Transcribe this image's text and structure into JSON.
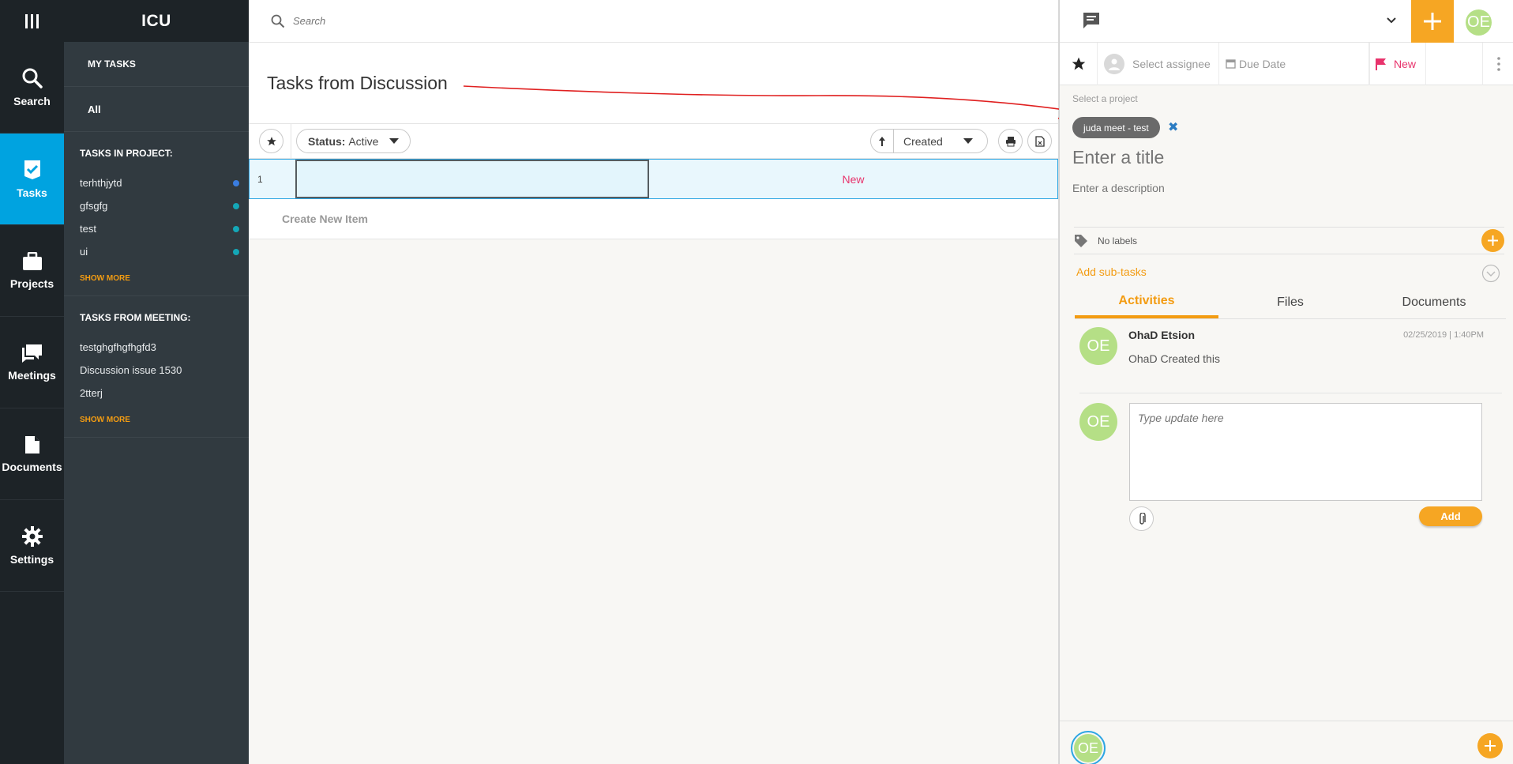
{
  "app": {
    "name": "ICU"
  },
  "rail": [
    {
      "key": "search",
      "label": "Search"
    },
    {
      "key": "tasks",
      "label": "Tasks"
    },
    {
      "key": "projects",
      "label": "Projects"
    },
    {
      "key": "meetings",
      "label": "Meetings"
    },
    {
      "key": "documents",
      "label": "Documents"
    },
    {
      "key": "settings",
      "label": "Settings"
    }
  ],
  "subnav": {
    "my_tasks": "MY TASKS",
    "all": "All",
    "projects_title": "TASKS IN PROJECT:",
    "projects": [
      {
        "name": "terhthjytd",
        "color": "#3a7de0"
      },
      {
        "name": "gfsgfg",
        "color": "#14a7b7"
      },
      {
        "name": "test",
        "color": "#14a7b7"
      },
      {
        "name": "ui",
        "color": "#14a7b7"
      }
    ],
    "meetings_title": "TASKS FROM MEETING:",
    "meetings": [
      "testghgfhgfhgfd3",
      "Discussion issue 1530",
      "2tterj"
    ],
    "show_more": "SHOW MORE"
  },
  "search": {
    "placeholder": "Search"
  },
  "main": {
    "title": "Tasks from Discussion",
    "status_label": "Status:",
    "status_value": "Active",
    "sort_value": "Created",
    "rows": [
      {
        "num": "1",
        "status": "New"
      }
    ],
    "create_new": "Create New Item"
  },
  "panel": {
    "assignee_placeholder": "Select assignee",
    "due_date": "Due Date",
    "status": "New",
    "project_label": "Select a project",
    "project_chip": "juda meet - test",
    "title_placeholder": "Enter a title",
    "desc_placeholder": "Enter a description",
    "labels": "No labels",
    "add_subtasks": "Add sub-tasks",
    "tabs": [
      "Activities",
      "Files",
      "Documents"
    ],
    "activity": {
      "user": "OhaD Etsion",
      "date": "02/25/2019 | 1:40PM",
      "text": "OhaD Created this",
      "initials": "OE"
    },
    "update_placeholder": "Type update here",
    "add_button": "Add",
    "user_initials": "OE"
  },
  "colors": {
    "accent": "#f6a623",
    "active_nav": "#00a3e0",
    "status_new": "#e8336c"
  }
}
